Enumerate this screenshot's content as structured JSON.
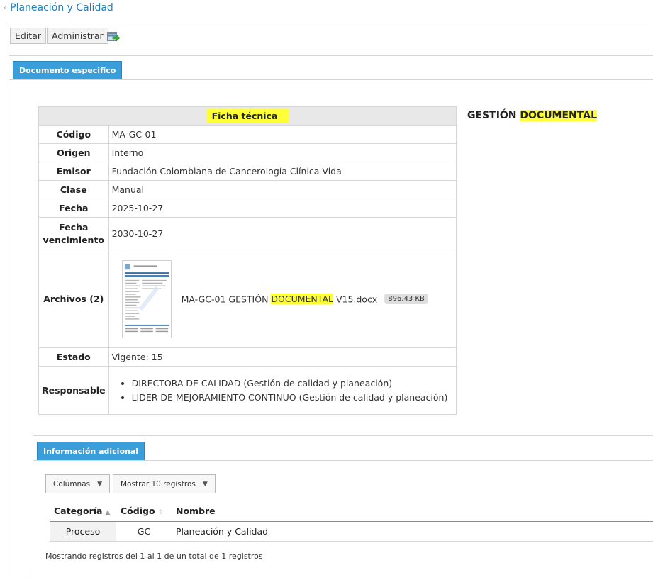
{
  "breadcrumb": {
    "separator": "»",
    "current": "Planeación y Calidad"
  },
  "toolbar": {
    "edit_label": "Editar",
    "admin_label": "Administrar",
    "export_icon": "export-to-file-icon"
  },
  "tabs": {
    "document": "Documento especifico",
    "info": "Información adicional"
  },
  "ficha": {
    "title": "Ficha técnica",
    "rows": {
      "codigo": {
        "label": "Código",
        "value": "MA-GC-01"
      },
      "origen": {
        "label": "Origen",
        "value": "Interno"
      },
      "emisor": {
        "label": "Emisor",
        "value": "Fundación Colombiana de Cancerología Clínica Vida"
      },
      "clase": {
        "label": "Clase",
        "value": "Manual"
      },
      "fecha": {
        "label": "Fecha",
        "value": "2025-10-27"
      },
      "vencimiento": {
        "label_line1": "Fecha",
        "label_line2": "vencimiento",
        "value": "2030-10-27"
      },
      "archivos": {
        "label": "Archivos (2)",
        "file_prefix": "MA-GC-01 GESTIÓN ",
        "file_highlight": "DOCUMENTAL",
        "file_suffix": " V15.docx",
        "size": "896.43 KB"
      },
      "estado": {
        "label": "Estado",
        "value": "Vigente: 15"
      },
      "responsable": {
        "label": "Responsable",
        "items": [
          "DIRECTORA DE CALIDAD (Gestión de calidad y planeación)",
          "LIDER DE MEJORAMIENTO CONTINUO (Gestión de calidad y planeación)"
        ]
      }
    }
  },
  "side_title": {
    "prefix": "GESTIÓN ",
    "highlight": "DOCUMENTAL"
  },
  "info_table": {
    "columns_button": "Columnas",
    "show_button": "Mostrar 10 registros",
    "headers": [
      "Categoría",
      "Código",
      "Nombre"
    ],
    "rows": [
      {
        "categoria": "Proceso",
        "codigo": "GC",
        "nombre": "Planeación y Calidad"
      }
    ],
    "footer": "Mostrando registros del 1 al 1 de un total de 1 registros"
  },
  "colors": {
    "tab_blue": "#3a9edb",
    "link_blue": "#1c7fc0",
    "highlight": "#ffff38"
  }
}
